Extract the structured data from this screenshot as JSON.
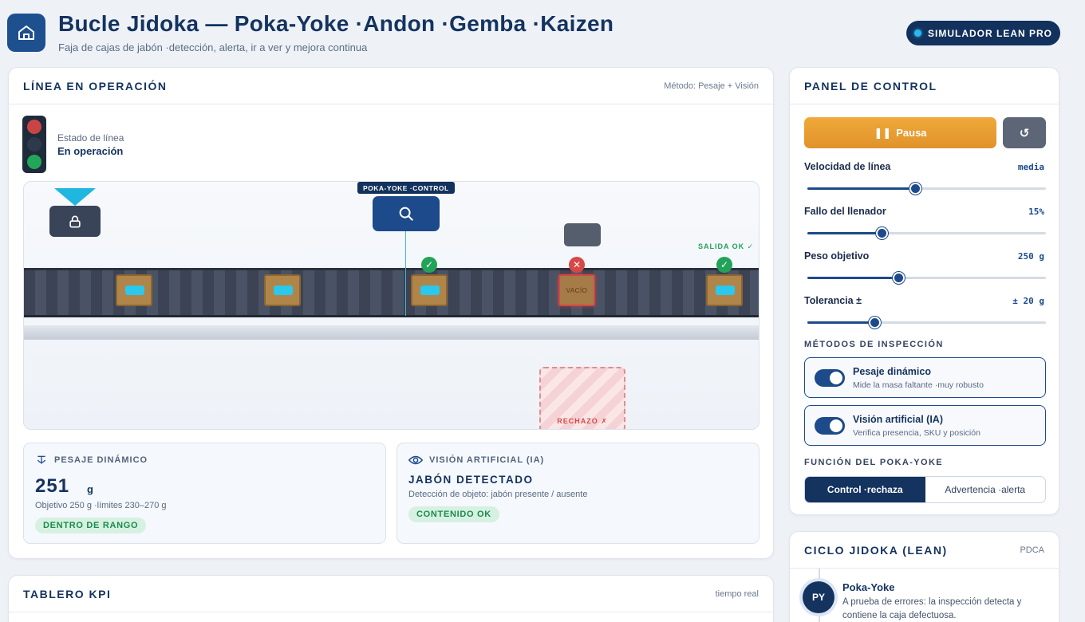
{
  "header": {
    "title": "Bucle Jidoka — Poka-Yoke  ·Andon  ·Gemba  ·Kaizen",
    "subtitle": "Faja de cajas de jabón  ·detección, alerta, ir a ver y mejora continua",
    "badge": "SIMULADOR LEAN PRO",
    "home_icon": "home-icon",
    "colors": {
      "primary": "#14335f",
      "accent": "#1fb6e0",
      "warning": "#e0922a",
      "ok": "#23a25a",
      "error": "#d84848"
    }
  },
  "line": {
    "title": "LÍNEA EN OPERACIÓN",
    "method": "Método: Pesaje + Visión",
    "state_label": "Estado de línea",
    "state_value": "En operación",
    "traffic_light_active": "green",
    "scene": {
      "pokayoke_tag": "POKA-YOKE  ·CONTROL",
      "exit_label": "SALIDA OK ✓",
      "empty_label": "VACÍO",
      "reject_label": "RECHAZO ✗",
      "boxes": [
        {
          "state": "filled"
        },
        {
          "state": "filled"
        },
        {
          "state": "filled",
          "check": "ok"
        },
        {
          "state": "empty",
          "check": "bad"
        },
        {
          "state": "filled",
          "check": "ok"
        }
      ]
    },
    "weight": {
      "title": "PESAJE DINÁMICO",
      "value": "251",
      "unit": "g",
      "desc": "Objetivo 250 g  ·límites 230–270 g",
      "status": "DENTRO DE RANGO"
    },
    "vision": {
      "title": "VISIÓN ARTIFICIAL (IA)",
      "result": "JABÓN DETECTADO",
      "desc": "Detección de objeto: jabón presente / ausente",
      "status": "CONTENIDO OK"
    }
  },
  "kpi": {
    "title": "TABLERO KPI",
    "meta": "tiempo real"
  },
  "control": {
    "title": "PANEL DE CONTROL",
    "pause_label": "Pausa",
    "reset_icon": "↺",
    "sliders": [
      {
        "label": "Velocidad de línea",
        "value": "media",
        "level": 0.45
      },
      {
        "label": "Fallo del llenador",
        "value": "15%",
        "level": 0.31
      },
      {
        "label": "Peso objetivo",
        "value": "250 g",
        "level": 0.38
      },
      {
        "label": "Tolerancia ±",
        "value": "± 20 g",
        "level": 0.28
      }
    ],
    "methods_title": "MÉTODOS DE INSPECCIÓN",
    "methods": [
      {
        "name": "Pesaje dinámico",
        "desc": "Mide la masa faltante  ·muy robusto",
        "enabled": true
      },
      {
        "name": "Visión artificial (IA)",
        "desc": "Verifica presencia, SKU y posición",
        "enabled": true
      }
    ],
    "function_title": "FUNCIÓN DEL POKA-YOKE",
    "function_options": [
      "Control  ·rechaza",
      "Advertencia  ·alerta"
    ],
    "function_selected": 0
  },
  "cycle": {
    "title": "CICLO JIDOKA (LEAN)",
    "meta": "PDCA",
    "steps": [
      {
        "abbr": "PY",
        "name": "Poka-Yoke",
        "desc": "A prueba de errores: la inspección detecta y contiene la caja defectuosa."
      }
    ]
  }
}
